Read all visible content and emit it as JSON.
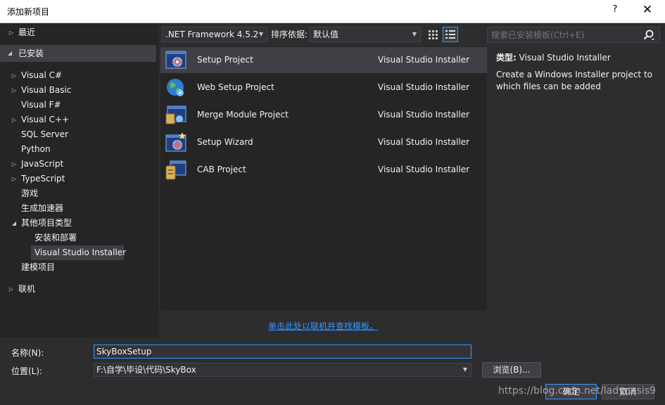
{
  "window": {
    "title": "添加新项目",
    "help": "?",
    "close": "✕"
  },
  "tree": {
    "recent": "最近",
    "installed": "已安装",
    "items": [
      {
        "label": "Visual C#"
      },
      {
        "label": "Visual Basic"
      },
      {
        "label": "Visual F#"
      },
      {
        "label": "Visual C++"
      },
      {
        "label": "SQL Server"
      },
      {
        "label": "Python"
      },
      {
        "label": "JavaScript"
      },
      {
        "label": "TypeScript"
      },
      {
        "label": "游戏"
      },
      {
        "label": "生成加速器"
      },
      {
        "label": "其他项目类型"
      },
      {
        "label": "安装和部署"
      },
      {
        "label": "Visual Studio Installer"
      },
      {
        "label": "建模项目"
      }
    ],
    "online": "联机"
  },
  "toolbar": {
    "framework": ".NET Framework 4.5.2",
    "sort_label": "排序依据:",
    "sort_value": "默认值"
  },
  "search": {
    "placeholder": "搜索已安装模板(Ctrl+E)"
  },
  "templates": [
    {
      "name": "Setup Project",
      "type": "Visual Studio Installer"
    },
    {
      "name": "Web Setup Project",
      "type": "Visual Studio Installer"
    },
    {
      "name": "Merge Module Project",
      "type": "Visual Studio Installer"
    },
    {
      "name": "Setup Wizard",
      "type": "Visual Studio Installer"
    },
    {
      "name": "CAB Project",
      "type": "Visual Studio Installer"
    }
  ],
  "detail": {
    "type_label": "类型:",
    "type_value": "Visual Studio Installer",
    "description": "Create a Windows Installer project to which files can be added"
  },
  "online_link": "单击此处以联机并查找模板。",
  "form": {
    "name_label": "名称(N):",
    "name_value": "SkyBoxSetup",
    "location_label": "位置(L):",
    "location_value": "F:\\自学\\毕设\\代码\\SkyBox",
    "browse": "浏览(B)...",
    "ok": "确定",
    "cancel": "取消"
  },
  "watermark": "https://blog.csdn.net/ladyoasis9",
  "colors": {
    "accent": "#3399ff",
    "panel": "#252526",
    "background": "#2d2d30",
    "selection": "#3f3f46"
  }
}
